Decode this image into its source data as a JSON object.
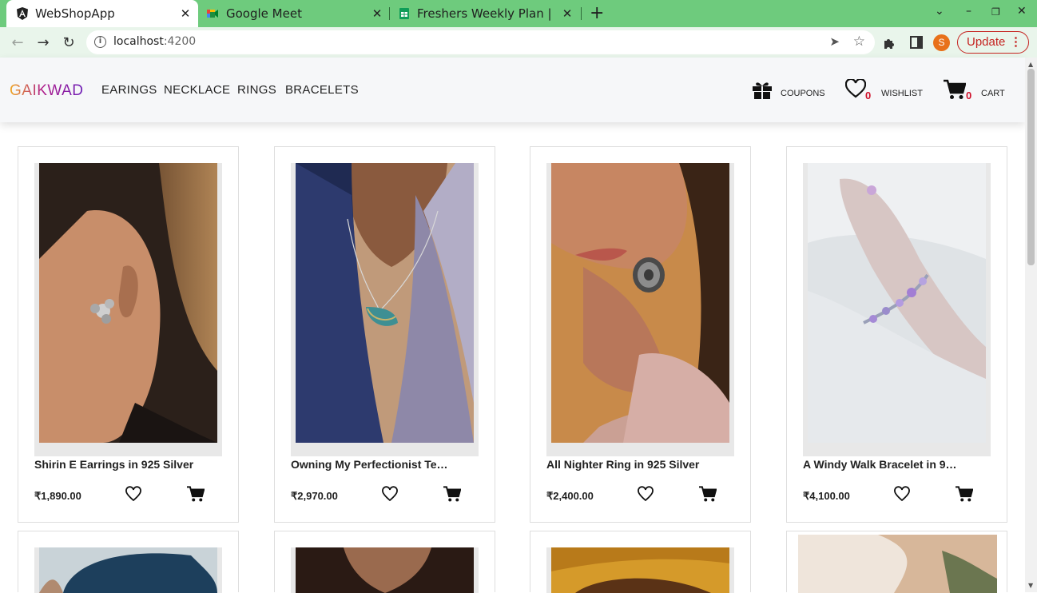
{
  "browser": {
    "tabs": [
      {
        "title": "WebShopApp",
        "active": true
      },
      {
        "title": "Google Meet",
        "active": false
      },
      {
        "title": "Freshers Weekly Plan | Sh",
        "active": false
      }
    ],
    "url_host": "localhost",
    "url_port": ":4200",
    "profile_initial": "S",
    "update_label": "Update"
  },
  "site": {
    "brand": "GAIKWAD",
    "menu": [
      "EARINGS",
      "NECKLACE",
      "RINGS",
      "BRACELETS"
    ],
    "coupons_label": "COUPONS",
    "wishlist_label": "WISHLIST",
    "wishlist_count": "0",
    "cart_label": "CART",
    "cart_count": "0"
  },
  "products": [
    {
      "name": "Shirin E Earrings in 925 Silver",
      "price": "₹1,890.00",
      "image": "woman-wearing-flower-earring"
    },
    {
      "name": "Owning My Perfectionist Te…",
      "price": "₹2,970.00",
      "image": "woman-wearing-pendant-necklace"
    },
    {
      "name": "All Nighter Ring in 925 Silver",
      "price": "₹2,400.00",
      "image": "woman-wearing-oxidised-ring"
    },
    {
      "name": "A Windy Walk Bracelet in 9…",
      "price": "₹4,100.00",
      "image": "hand-wearing-gemstone-bracelet"
    }
  ],
  "colors": {
    "tab_strip": "#6ecb7d",
    "toolbar": "#e9f5eb",
    "badge": "#d0112b",
    "update": "#c5221f"
  }
}
